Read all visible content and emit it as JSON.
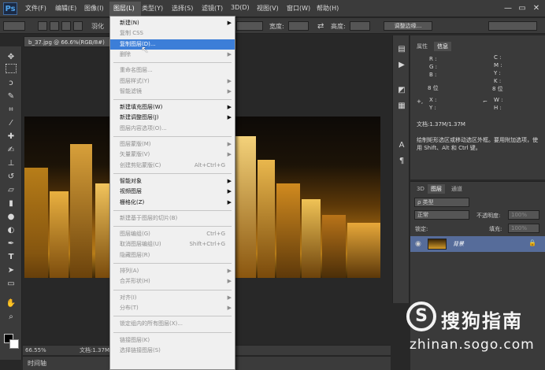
{
  "app": {
    "logo": "Ps"
  },
  "menubar": {
    "items": [
      "文件(F)",
      "编辑(E)",
      "图像(I)",
      "图层(L)",
      "类型(Y)",
      "选择(S)",
      "滤镜(T)",
      "3D(D)",
      "视图(V)",
      "窗口(W)",
      "帮助(H)"
    ],
    "window_controls": [
      "—",
      "▭",
      "✕"
    ]
  },
  "options_bar": {
    "feather_label": "羽化",
    "width_label": "宽度:",
    "height_label": "高度:",
    "refine_edge_button": "调整边缘..."
  },
  "document": {
    "tab_title": "b_37.jpg @ 66.6%(RGB/8#)",
    "zoom": "66.55%",
    "doc_size": "文档:1.37M"
  },
  "timeline": {
    "label": "时间轴"
  },
  "layer_menu": {
    "items": [
      {
        "label": "新建(N)",
        "arrow": true
      },
      {
        "label": "复制 CSS",
        "disabled": true
      },
      {
        "label": "复制图层(D)...",
        "highlighted": true
      },
      {
        "label": "删除",
        "arrow": true,
        "disabled": true
      },
      {
        "sep": true
      },
      {
        "label": "重命名图层...",
        "disabled": true
      },
      {
        "label": "图层样式(Y)",
        "arrow": true,
        "disabled": true
      },
      {
        "label": "智能滤镜",
        "arrow": true,
        "disabled": true
      },
      {
        "sep": true
      },
      {
        "label": "新建填充图层(W)",
        "arrow": true
      },
      {
        "label": "新建调整图层(J)",
        "arrow": true
      },
      {
        "label": "图层内容选项(O)...",
        "disabled": true
      },
      {
        "sep": true
      },
      {
        "label": "图层蒙版(M)",
        "arrow": true,
        "disabled": true
      },
      {
        "label": "矢量蒙版(V)",
        "arrow": true,
        "disabled": true
      },
      {
        "label": "创建剪贴蒙版(C)",
        "shortcut": "Alt+Ctrl+G",
        "disabled": true
      },
      {
        "sep": true
      },
      {
        "label": "智能对象",
        "arrow": true
      },
      {
        "label": "视频图层",
        "arrow": true
      },
      {
        "label": "栅格化(Z)",
        "arrow": true
      },
      {
        "sep": true
      },
      {
        "label": "新建基于图层的切片(B)",
        "disabled": true
      },
      {
        "sep": true
      },
      {
        "label": "图层编组(G)",
        "shortcut": "Ctrl+G",
        "disabled": true
      },
      {
        "label": "取消图层编组(U)",
        "shortcut": "Shift+Ctrl+G",
        "disabled": true
      },
      {
        "label": "隐藏图层(R)",
        "disabled": true
      },
      {
        "sep": true
      },
      {
        "label": "排列(A)",
        "arrow": true,
        "disabled": true
      },
      {
        "label": "合并形状(H)",
        "arrow": true,
        "disabled": true
      },
      {
        "sep": true
      },
      {
        "label": "对齐(I)",
        "arrow": true,
        "disabled": true
      },
      {
        "label": "分布(T)",
        "arrow": true,
        "disabled": true
      },
      {
        "sep": true
      },
      {
        "label": "锁定组内的所有图层(X)...",
        "disabled": true
      },
      {
        "sep": true
      },
      {
        "label": "链接图层(K)",
        "disabled": true
      },
      {
        "label": "选择链接图层(S)",
        "disabled": true
      }
    ]
  },
  "info_panel": {
    "tabs": [
      "属性",
      "信息"
    ],
    "rgb_labels": [
      "R :",
      "G :",
      "B :"
    ],
    "cmyk_labels": [
      "C :",
      "M :",
      "Y :",
      "K :"
    ],
    "bit_depth_left": "8 位",
    "bit_depth_right": "8 位",
    "xy_labels": [
      "X :",
      "Y :"
    ],
    "wh_labels": [
      "W :",
      "H :"
    ],
    "doc_size": "文档:1.37M/1.37M",
    "hint": "绘制矩形选区或移动选区外框。要用附加选项，使用 Shift、Alt 和 Ctrl 键。"
  },
  "layers_panel": {
    "tabs": [
      "3D",
      "图层",
      "通道"
    ],
    "filter_label": "ρ 类型",
    "blend_mode": "正常",
    "opacity_label": "不透明度:",
    "opacity_value": "100%",
    "lock_label": "锁定:",
    "fill_label": "填充:",
    "fill_value": "100%",
    "layer_name": "背景"
  },
  "watermark": {
    "logo": "S",
    "title": "搜狗指南",
    "url": "zhinan.sogo.com"
  },
  "icons": [
    "marquee-icon",
    "move-icon",
    "lasso-icon",
    "quick-select-icon",
    "crop-icon",
    "eyedropper-icon",
    "brush-icon",
    "eye-icon",
    "lock-icon",
    "hand-icon",
    "zoom-icon",
    "type-icon"
  ]
}
